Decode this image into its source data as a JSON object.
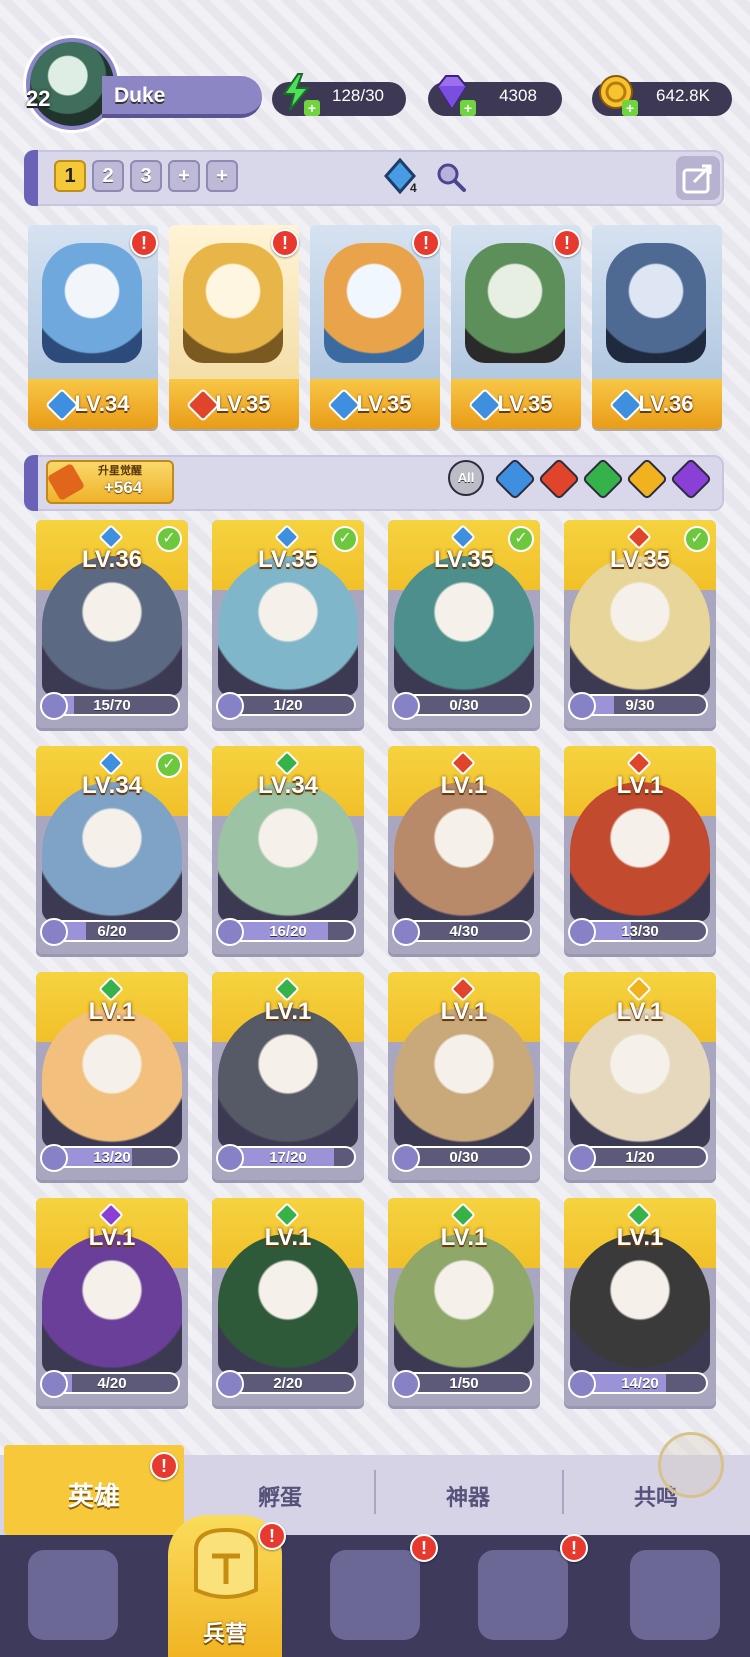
{
  "player": {
    "level": "22",
    "name": "Duke"
  },
  "resources": {
    "energy": "128/30",
    "gems": "4308",
    "coins": "642.8K"
  },
  "team": {
    "slots": [
      "1",
      "2",
      "3",
      "+",
      "+"
    ],
    "gem_badge": "4",
    "heroes": [
      {
        "level": "LV.34",
        "element": "water",
        "alert": true
      },
      {
        "level": "LV.35",
        "element": "fire",
        "alert": true
      },
      {
        "level": "LV.35",
        "element": "water",
        "alert": true
      },
      {
        "level": "LV.35",
        "element": "water",
        "alert": true
      },
      {
        "level": "LV.36",
        "element": "water",
        "alert": false
      }
    ]
  },
  "filter": {
    "awaken_title": "升星觉醒",
    "awaken_value": "+564",
    "all_label": "All",
    "elements": [
      "water",
      "fire",
      "nature",
      "light",
      "dark"
    ]
  },
  "heroes": [
    {
      "level": "LV.36",
      "progress": "15/70",
      "progress_pct": 21,
      "element": "water",
      "check": true
    },
    {
      "level": "LV.35",
      "progress": "1/20",
      "progress_pct": 5,
      "element": "water",
      "check": true
    },
    {
      "level": "LV.35",
      "progress": "0/30",
      "progress_pct": 0,
      "element": "water",
      "check": true
    },
    {
      "level": "LV.35",
      "progress": "9/30",
      "progress_pct": 30,
      "element": "fire",
      "check": true
    },
    {
      "level": "LV.34",
      "progress": "6/20",
      "progress_pct": 30,
      "element": "water",
      "check": true
    },
    {
      "level": "LV.34",
      "progress": "16/20",
      "progress_pct": 80,
      "element": "nature",
      "check": false
    },
    {
      "level": "LV.1",
      "progress": "4/30",
      "progress_pct": 13,
      "element": "fire",
      "check": false
    },
    {
      "level": "LV.1",
      "progress": "13/30",
      "progress_pct": 43,
      "element": "fire",
      "check": false
    },
    {
      "level": "LV.1",
      "progress": "13/20",
      "progress_pct": 65,
      "element": "nature",
      "check": false
    },
    {
      "level": "LV.1",
      "progress": "17/20",
      "progress_pct": 85,
      "element": "nature",
      "check": false
    },
    {
      "level": "LV.1",
      "progress": "0/30",
      "progress_pct": 0,
      "element": "fire",
      "check": false
    },
    {
      "level": "LV.1",
      "progress": "1/20",
      "progress_pct": 5,
      "element": "light",
      "check": false
    },
    {
      "level": "LV.1",
      "progress": "4/20",
      "progress_pct": 20,
      "element": "dark",
      "check": false
    },
    {
      "level": "LV.1",
      "progress": "2/20",
      "progress_pct": 10,
      "element": "nature",
      "check": false
    },
    {
      "level": "LV.1",
      "progress": "1/50",
      "progress_pct": 2,
      "element": "nature",
      "check": false
    },
    {
      "level": "LV.1",
      "progress": "14/20",
      "progress_pct": 70,
      "element": "nature",
      "check": false
    }
  ],
  "tabs": [
    "英雄",
    "孵蛋",
    "神器",
    "共鸣"
  ],
  "nav": {
    "active_label": "兵营"
  },
  "alert_mark": "!",
  "check_mark": "✓",
  "colors": {
    "water": "#3f8fe0",
    "fire": "#e0452b",
    "nature": "#35b24a",
    "light": "#f0b21f",
    "dark": "#8a3fd6",
    "accent": "#f6c83a"
  }
}
